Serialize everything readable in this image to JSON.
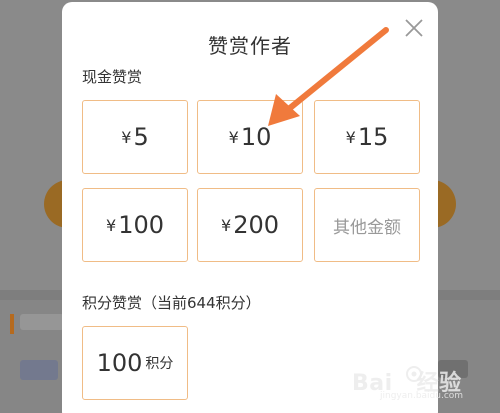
{
  "modal": {
    "title": "赞赏作者",
    "close_icon": "close-icon"
  },
  "cash": {
    "label": "现金赞赏",
    "currency": "¥",
    "options": [
      {
        "amount": "5"
      },
      {
        "amount": "10"
      },
      {
        "amount": "15"
      },
      {
        "amount": "100"
      },
      {
        "amount": "200"
      }
    ],
    "other_label": "其他金额"
  },
  "points": {
    "label": "积分赞赏（当前644积分）",
    "option_value": "100",
    "option_unit": "积分"
  },
  "watermark": {
    "brand": "Bai",
    "brand_suffix": "经验",
    "sub": "jingyan.baidu.com"
  },
  "colors": {
    "option_border": "#f0bc86",
    "arrow": "#f07a3c",
    "overlay": "#8a8a8a"
  }
}
